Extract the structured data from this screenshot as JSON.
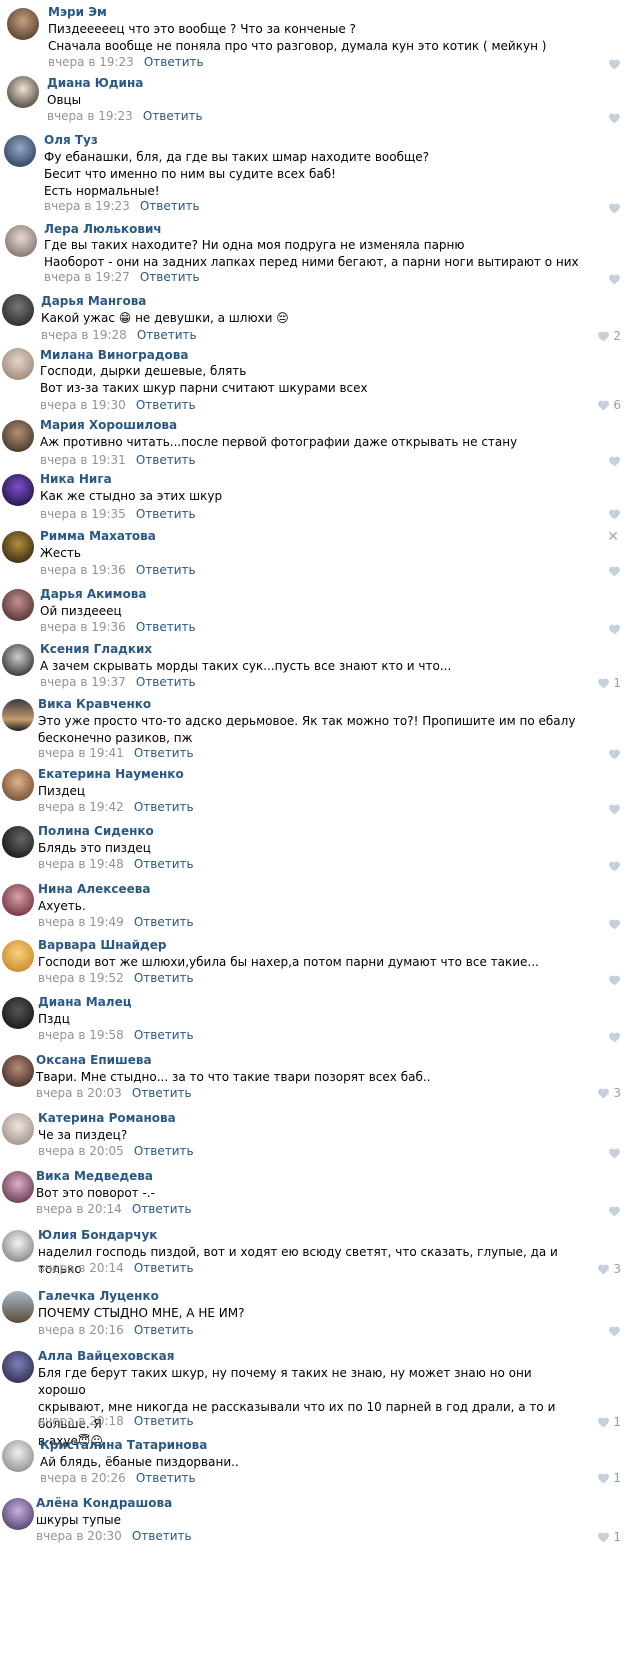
{
  "reply_label": "Ответить",
  "comments": [
    {
      "name": "Мэри Эм",
      "text": "Пиздееееец что это вообще ? Что за конченые ?\nСначала вообще не поняла про что разговор, думала кун это котик ( мейкун )",
      "time": "вчера в 19:23",
      "likes": ""
    },
    {
      "name": "Диана Юдина",
      "text": "Овцы",
      "time": "вчера в 19:23",
      "likes": ""
    },
    {
      "name": "Оля Туз",
      "text": "Фу ебанашки, бля, да где вы таких шмар находите вообще?\nБесит что именно по ним вы судите всех баб!\nЕсть нормальные!",
      "time": "вчера в 19:23",
      "likes": ""
    },
    {
      "name": "Лера Люлькович",
      "text": "Где вы таких находите? Ни одна моя подруга не изменяла парню\nНаоборот - они на задних лапках перед ними бегают, а парни ноги вытирают о них",
      "time": "вчера в 19:27",
      "likes": ""
    },
    {
      "name": "Дарья Мангова",
      "text": "Какой ужас 😁 не девушки, а шлюхи 😔",
      "time": "вчера в 19:28",
      "likes": "2"
    },
    {
      "name": "Милана Виноградова",
      "text": "Господи, дырки дешевые, блять\nВот из-за таких шкур парни считают шкурами всех",
      "time": "вчера в 19:30",
      "likes": "6"
    },
    {
      "name": "Мария Хорошилова",
      "text": "Аж противно читать...после первой фотографии даже открывать не стану",
      "time": "вчера в 19:31",
      "likes": ""
    },
    {
      "name": "Ника Нига",
      "text": "Как же стыдно за этих шкур",
      "time": "вчера в 19:35",
      "likes": ""
    },
    {
      "name": "Римма Махатова",
      "text": "Жесть",
      "time": "вчера в 19:36",
      "likes": ""
    },
    {
      "name": "Дарья Акимова",
      "text": "Ой пиздееец",
      "time": "вчера в 19:36",
      "likes": ""
    },
    {
      "name": "Ксения Гладких",
      "text": "А зачем скрывать морды таких сук...пусть все знают кто и что...",
      "time": "вчера в 19:37",
      "likes": "1"
    },
    {
      "name": "Вика Кравченко",
      "text": "Это уже просто что-то адско дерьмовое. Як так можно то?! Пропишите им по ебалу\nбесконечно разиков, пж",
      "time": "вчера в 19:41",
      "likes": ""
    },
    {
      "name": "Екатерина Науменко",
      "text": "Пиздец",
      "time": "вчера в 19:42",
      "likes": ""
    },
    {
      "name": "Полина Сиденко",
      "text": "Блядь это пиздец",
      "time": "вчера в 19:48",
      "likes": ""
    },
    {
      "name": "Нина Алексеева",
      "text": "Ахуеть.",
      "time": "вчера в 19:49",
      "likes": ""
    },
    {
      "name": "Варвара Шнайдер",
      "text": "Господи вот же шлюхи,убила бы нахер,а потом парни думают что все такие...",
      "time": "вчера в 19:52",
      "likes": ""
    },
    {
      "name": "Диана Малец",
      "text": "Пздц",
      "time": "вчера в 19:58",
      "likes": ""
    },
    {
      "name": "Оксана Епишева",
      "text": "Твари. Мне стыдно... за то что такие твари позорят всех баб..",
      "time": "вчера в 20:03",
      "likes": "3"
    },
    {
      "name": "Катерина Романова",
      "text": "Че за пиздец?",
      "time": "вчера в 20:05",
      "likes": ""
    },
    {
      "name": "Вика Медведева",
      "text": "Вот это поворот -.-",
      "time": "вчера в 20:14",
      "likes": ""
    },
    {
      "name": "Юлия Бондарчук",
      "text": "наделил господь пиздой, вот и ходят ею всюду светят, что сказать, глупые, да и только",
      "time": "вчера в 20:14",
      "likes": "3"
    },
    {
      "name": "Галечка Луценко",
      "text": "ПОЧЕМУ СТЫДНО МНЕ, А НЕ ИМ?",
      "time": "вчера в 20:16",
      "likes": ""
    },
    {
      "name": "Алла Вайцеховская",
      "text": "Бля где берут таких шкур, ну почему я таких не знаю, ну может знаю но они хорошо\nскрывают, мне никогда не рассказывали что их по 10 парней в год драли, а то и больше. Я\nв ахуе😇😐",
      "time": "вчера в 20:18",
      "likes": "1"
    },
    {
      "name": "Кристалина Татаринова",
      "text": "Ай блядь, ёбаные пиздорвани..",
      "time": "вчера в 20:26",
      "likes": "1"
    },
    {
      "name": "Алёна Кондрашова",
      "text": "шкуры тупые",
      "time": "вчера в 20:30",
      "likes": "1"
    }
  ],
  "colors": {
    "name": "#2a5885",
    "meta": "#939393",
    "like": "#8fa1b4"
  }
}
